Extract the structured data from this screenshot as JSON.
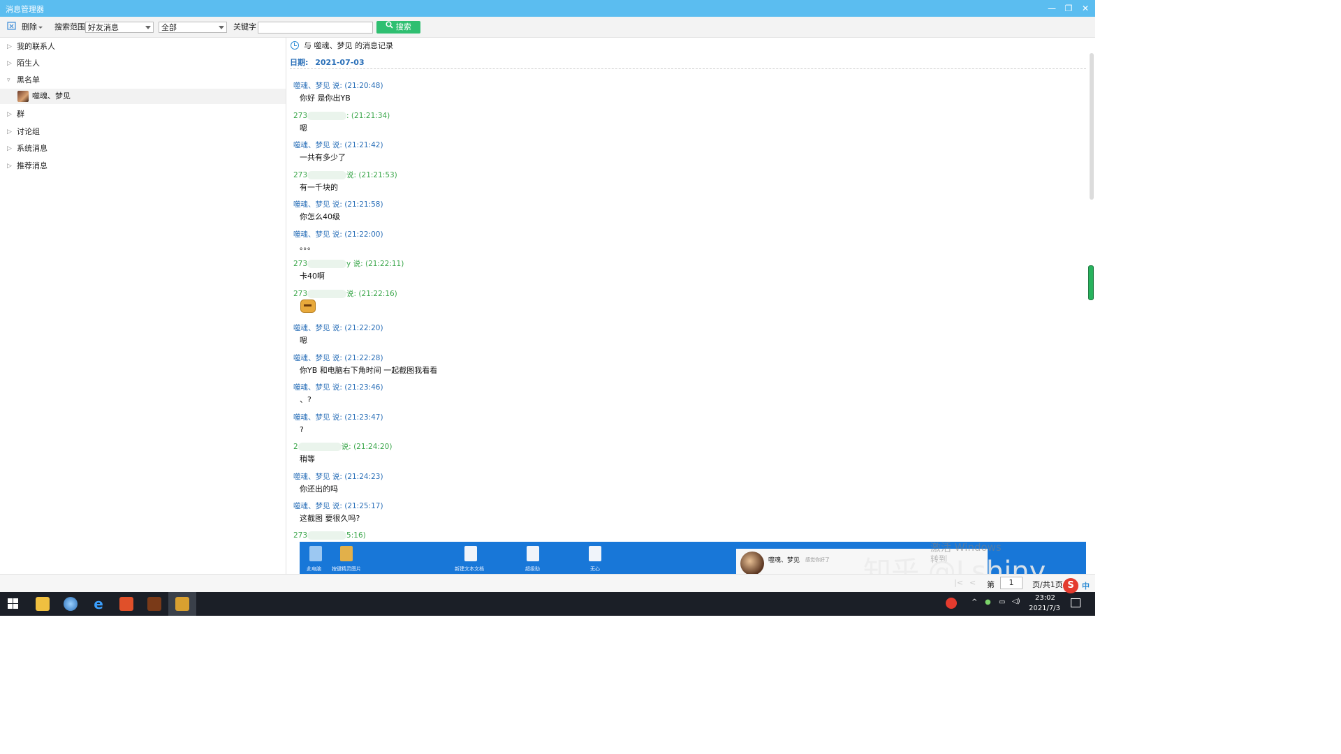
{
  "window": {
    "title": "消息管理器",
    "minimize": "—",
    "restore": "❐",
    "close": "✕"
  },
  "toolbar": {
    "delete_label": "删除",
    "range_label": "搜索范围",
    "range_value": "好友消息",
    "scope_value": "全部",
    "keyword_label": "关键字",
    "keyword_value": "",
    "search_label": "搜索"
  },
  "sidebar": {
    "items": [
      {
        "label": "我的联系人",
        "expanded": false
      },
      {
        "label": "陌生人",
        "expanded": false
      },
      {
        "label": "黑名单",
        "expanded": true
      },
      {
        "label": "噬魂、梦见",
        "child": true
      },
      {
        "label": "群",
        "expanded": false
      },
      {
        "label": "讨论组",
        "expanded": false
      },
      {
        "label": "系统消息",
        "expanded": false
      },
      {
        "label": "推荐消息",
        "expanded": false
      }
    ]
  },
  "chat": {
    "title": "与 噬魂、梦见 的消息记录",
    "date_label": "日期:",
    "date_value": "2021-07-03",
    "messages": [
      {
        "sender": "噬魂、梦见 说:",
        "time": "(21:20:48)",
        "text": "你好 是你出YB",
        "mine": true
      },
      {
        "sender": "273",
        "time": ": (21:21:34)",
        "text": "嗯",
        "mine": false
      },
      {
        "sender": "噬魂、梦见 说:",
        "time": "(21:21:42)",
        "text": "一共有多少了",
        "mine": true
      },
      {
        "sender": "273",
        "time": "说: (21:21:53)",
        "text": "有一千块的",
        "mine": false
      },
      {
        "sender": "噬魂、梦见 说:",
        "time": "(21:21:58)",
        "text": "你怎么40级",
        "mine": true
      },
      {
        "sender": "噬魂、梦见 说:",
        "time": "(21:22:00)",
        "text": "。。。",
        "mine": true
      },
      {
        "sender": "273",
        "time": "y 说: (21:22:11)",
        "text": "卡40啊",
        "mine": false
      },
      {
        "sender": "273",
        "time": "说: (21:22:16)",
        "text": "",
        "emoji": "face-emoji",
        "mine": false
      },
      {
        "sender": "噬魂、梦见 说:",
        "time": "(21:22:20)",
        "text": "嗯",
        "mine": true
      },
      {
        "sender": "噬魂、梦见 说:",
        "time": "(21:22:28)",
        "text": "你YB 和电脑右下角时间 一起截图我看看",
        "mine": true
      },
      {
        "sender": "噬魂、梦见 说:",
        "time": "(21:23:46)",
        "text": "、?",
        "mine": true
      },
      {
        "sender": "噬魂、梦见 说:",
        "time": "(21:23:47)",
        "text": "?",
        "mine": true
      },
      {
        "sender": "2",
        "time": "说: (21:24:20)",
        "text": "稍等",
        "mine": false
      },
      {
        "sender": "噬魂、梦见 说:",
        "time": "(21:24:23)",
        "text": "你还出的吗",
        "mine": true
      },
      {
        "sender": "噬魂、梦见 说:",
        "time": "(21:25:17)",
        "text": "这截图 要很久吗?",
        "mine": true
      },
      {
        "sender": "273",
        "time": "5:16)",
        "text": "",
        "mine": false
      }
    ],
    "screenshot_labels": [
      "此电脑",
      "按键精灵图片",
      "新建文本文档",
      "超级助",
      "无心"
    ],
    "screenshot_card_name": "噬魂、梦见",
    "screenshot_card_status": "感觉你好了"
  },
  "watermarks": {
    "win1": "激活 Windows",
    "win2": "转到",
    "zhihu": "知乎 @Lshiny"
  },
  "pagination": {
    "prefix": "第",
    "page": "1",
    "suffix": "页/共1页"
  },
  "taskbar": {
    "time": "23:02",
    "date": "2021/7/3",
    "ime": "中"
  }
}
